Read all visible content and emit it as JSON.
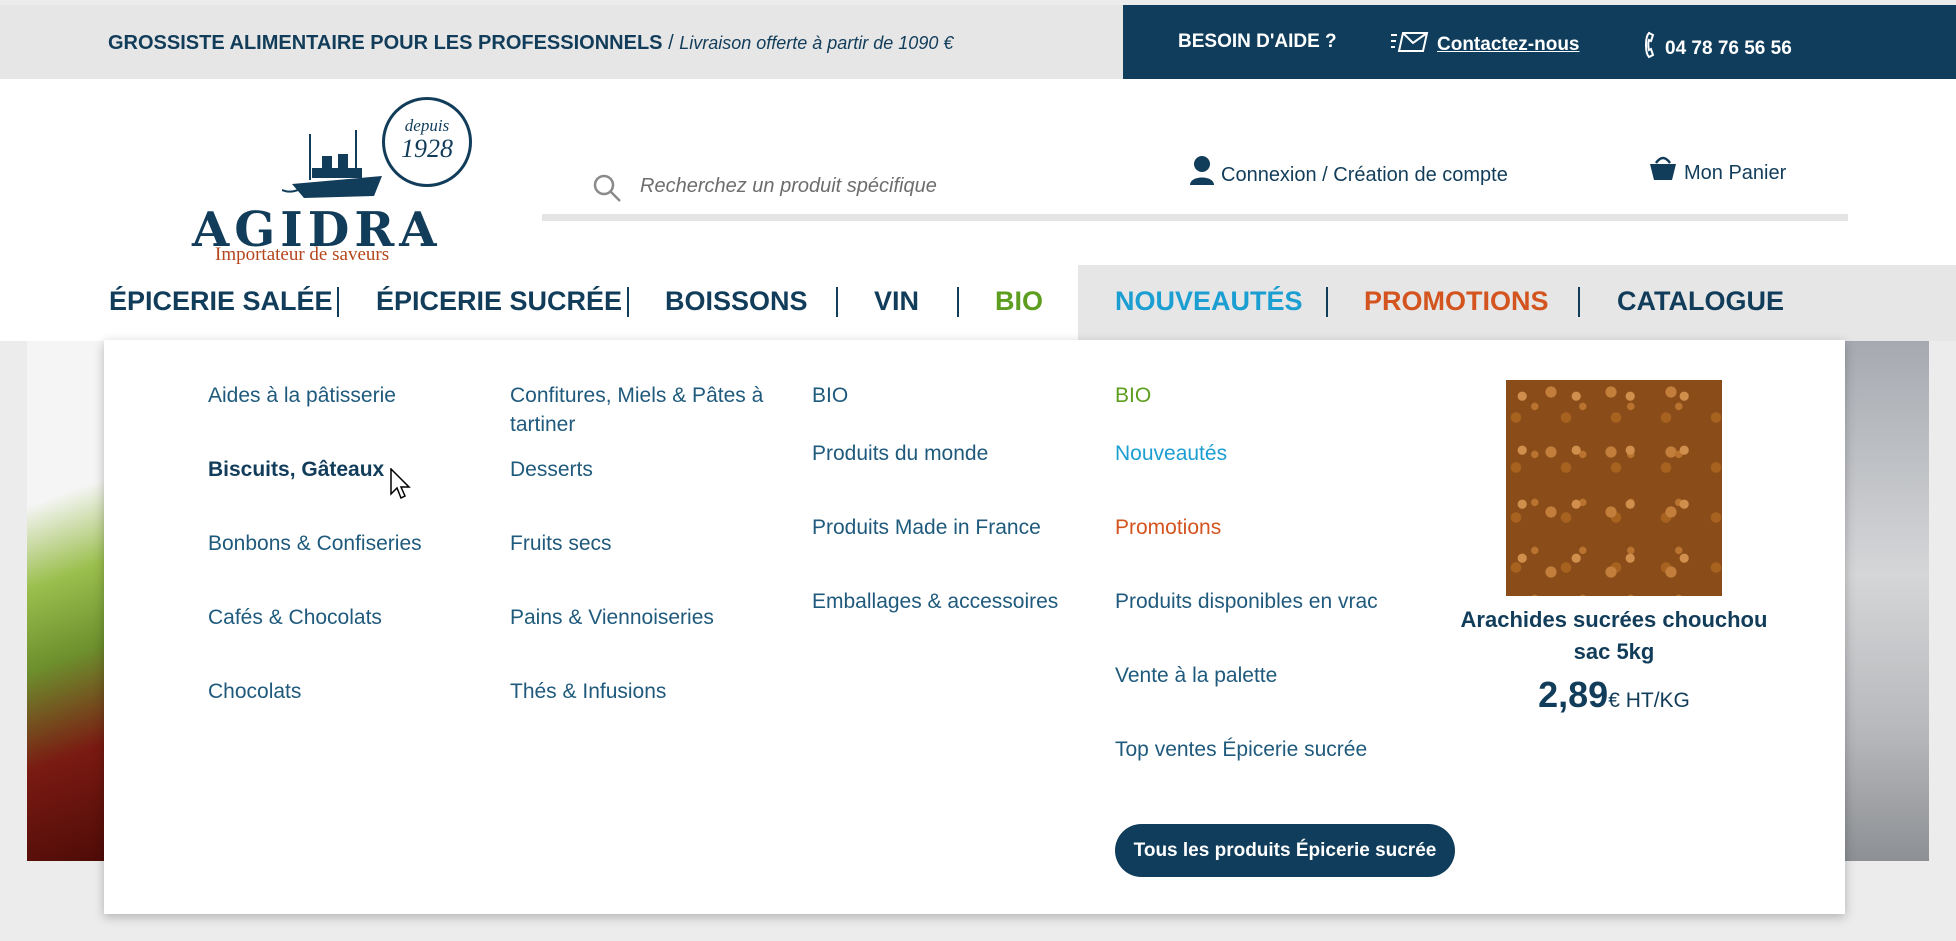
{
  "topbar": {
    "tagline_bold": "GROSSISTE ALIMENTAIRE POUR LES PROFESSIONNELS",
    "tagline_sep": " / ",
    "tagline_italic": "Livraison offerte à partir de 1090 €",
    "help_label": "BESOIN D'AIDE ?",
    "contact_label": "Contactez-nous",
    "phone": "04 78 76 56 56"
  },
  "logo": {
    "name": "AGIDRA",
    "subtitle": "Importateur de saveurs",
    "seal_top": "depuis",
    "seal_year": "1928"
  },
  "header": {
    "search_placeholder": "Recherchez un produit spécifique",
    "account_label": "Connexion / Création de compte",
    "cart_label": "Mon Panier"
  },
  "nav": {
    "items": [
      {
        "label": "ÉPICERIE SALÉE",
        "color": "#123d5a"
      },
      {
        "label": "ÉPICERIE SUCRÉE",
        "color": "#123d5a"
      },
      {
        "label": "BOISSONS",
        "color": "#123d5a"
      },
      {
        "label": "VIN",
        "color": "#123d5a"
      },
      {
        "label": "BIO",
        "color": "#5d9d1f"
      },
      {
        "label": "NOUVEAUTÉS",
        "color": "#1b9ed1"
      },
      {
        "label": "PROMOTIONS",
        "color": "#d4541f"
      },
      {
        "label": "CATALOGUE",
        "color": "#123d5a"
      }
    ]
  },
  "dropdown": {
    "col1": [
      "Aides à la pâtisserie",
      "Biscuits, Gâteaux",
      "Bonbons & Confiseries",
      "Cafés & Chocolats",
      "Chocolats"
    ],
    "col2": [
      "Confitures, Miels & Pâtes à tartiner",
      "Desserts",
      "Fruits secs",
      "Pains & Viennoiseries",
      "Thés & Infusions"
    ],
    "col3": [
      "BIO",
      "Produits du monde",
      "Produits Made in France",
      "Emballages & accessoires"
    ],
    "col4": [
      "BIO",
      "Nouveautés",
      "Promotions",
      "Produits disponibles en vrac",
      "Vente à la palette",
      "Top ventes Épicerie sucrée"
    ],
    "all_button": "Tous les produits Épicerie sucrée",
    "product": {
      "name": "Arachides sucrées chouchou sac 5kg",
      "price": "2,89",
      "unit": "€ HT/KG"
    }
  },
  "colors": {
    "brand_dark": "#0f3d5b",
    "bio_green": "#5d9d1f",
    "new_blue": "#1b9ed1",
    "promo_orange": "#d4541f"
  }
}
